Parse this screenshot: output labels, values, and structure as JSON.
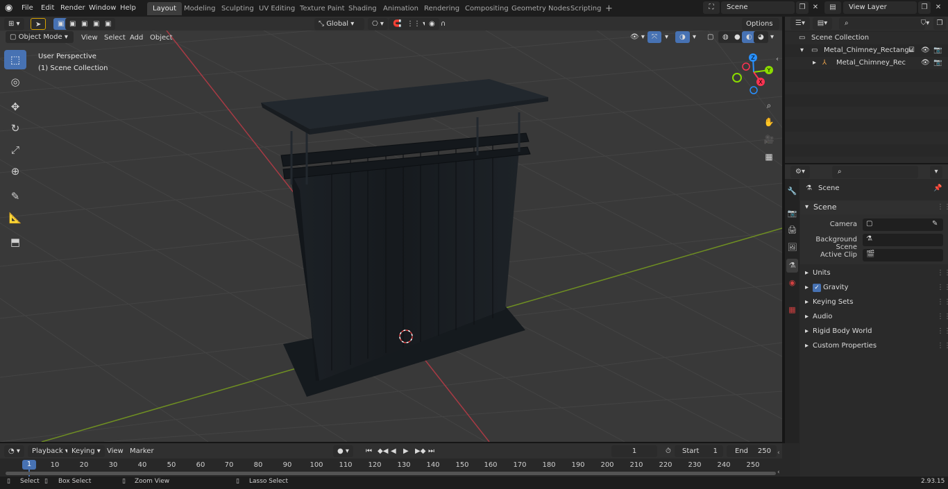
{
  "menu": {
    "items": [
      "File",
      "Edit",
      "Render",
      "Window",
      "Help"
    ]
  },
  "workspaces": {
    "active": "Layout",
    "tabs": [
      "Layout",
      "Modeling",
      "Sculpting",
      "UV Editing",
      "Texture Paint",
      "Shading",
      "Animation",
      "Rendering",
      "Compositing",
      "Geometry Nodes",
      "Scripting"
    ],
    "add_label": "+"
  },
  "scene_field": "Scene",
  "view_layer_field": "View Layer",
  "viewport_header": {
    "mode": "Object Mode",
    "menus": [
      "View",
      "Select",
      "Add",
      "Object"
    ],
    "transform_orientation": "Global",
    "options_label": "Options"
  },
  "viewport_overlay": {
    "perspective": "User Perspective",
    "collection": "(1) Scene Collection"
  },
  "gizmo": {
    "axes": [
      "Z",
      "Y",
      "X"
    ],
    "colors": {
      "x": "#ff3352",
      "y": "#8bdc00",
      "z": "#2890ff"
    }
  },
  "outliner": {
    "rows": [
      {
        "label": "Scene Collection",
        "level": 0
      },
      {
        "label": "Metal_Chimney_Rectangular_",
        "level": 1
      },
      {
        "label": "Metal_Chimney_Rectang",
        "level": 2
      }
    ]
  },
  "properties": {
    "context": "Scene",
    "panel_title": "Scene",
    "fields": [
      {
        "label": "Camera"
      },
      {
        "label": "Background Scene"
      },
      {
        "label": "Active Clip"
      }
    ],
    "subpanels": [
      "Units",
      "Gravity",
      "Keying Sets",
      "Audio",
      "Rigid Body World",
      "Custom Properties"
    ],
    "gravity_checked": true
  },
  "timeline": {
    "menus": [
      "Playback",
      "Keying",
      "View",
      "Marker"
    ],
    "current_frame": "1",
    "start_label": "Start",
    "start_value": "1",
    "end_label": "End",
    "end_value": "250",
    "ruler_current": "1",
    "ruler_ticks": [
      "10",
      "20",
      "30",
      "40",
      "50",
      "60",
      "70",
      "80",
      "90",
      "100",
      "110",
      "120",
      "130",
      "140",
      "150",
      "160",
      "170",
      "180",
      "190",
      "200",
      "210",
      "220",
      "230",
      "240",
      "250"
    ]
  },
  "statusbar": {
    "select": "Select",
    "box_select": "Box Select",
    "zoom_view": "Zoom View",
    "lasso_select": "Lasso Select",
    "version": "2.93.15"
  },
  "colors": {
    "accent": "#4772b3",
    "viewport_bg": "#393939",
    "object": "#1a1f24"
  }
}
